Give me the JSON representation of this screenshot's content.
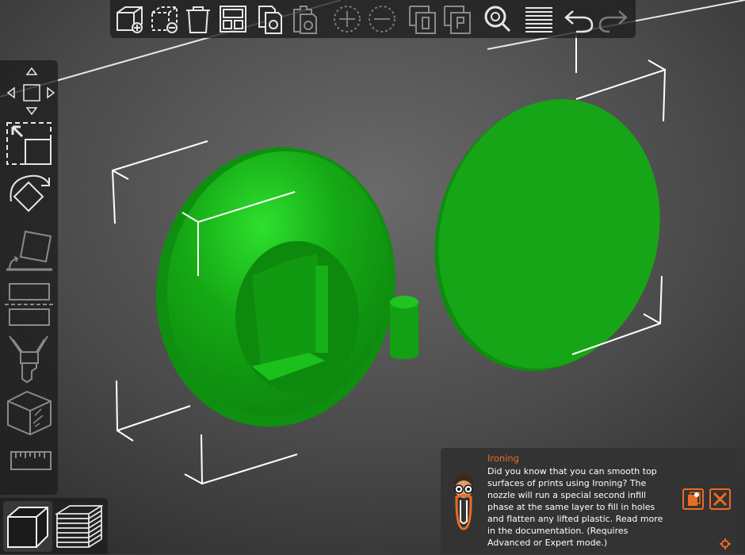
{
  "scene": {
    "model_color": "#19a019",
    "objects": [
      "disc-with-cone",
      "pin",
      "flat-disc"
    ]
  },
  "toolbar_top": {
    "buttons": [
      {
        "name": "add",
        "icon": "add-cube-icon"
      },
      {
        "name": "delete",
        "icon": "delete-cube-icon"
      },
      {
        "name": "delete-all",
        "icon": "trash-icon"
      },
      {
        "name": "arrange",
        "icon": "arrange-icon"
      },
      {
        "name": "copy",
        "icon": "copy-icon"
      },
      {
        "name": "paste",
        "icon": "paste-icon"
      },
      {
        "name": "instance-add",
        "icon": "plus-circle-icon"
      },
      {
        "name": "instance-remove",
        "icon": "minus-circle-icon"
      },
      {
        "name": "split-objects",
        "icon": "split-objects-icon"
      },
      {
        "name": "split-parts",
        "icon": "split-parts-icon"
      },
      {
        "name": "search",
        "icon": "search-icon"
      },
      {
        "name": "layers-editing",
        "icon": "layers-icon"
      },
      {
        "name": "undo",
        "icon": "undo-icon"
      },
      {
        "name": "redo",
        "icon": "redo-icon"
      }
    ]
  },
  "toolbar_left": {
    "tools": [
      "move",
      "scale",
      "rotate",
      "place-on-face",
      "cut",
      "paint-supports",
      "seam",
      "measure"
    ]
  },
  "view_tabs": [
    "3d-view",
    "preview"
  ],
  "hint": {
    "title": "Ironing",
    "body": "Did you know that you can smooth top surfaces of prints using Ironing? The nozzle will run a special second infill phase at the same layer to fill in holes and flatten any lifted plastic. Read more in the documentation. (Requires Advanced or Expert mode.)",
    "accent_color": "#ed6b21"
  }
}
